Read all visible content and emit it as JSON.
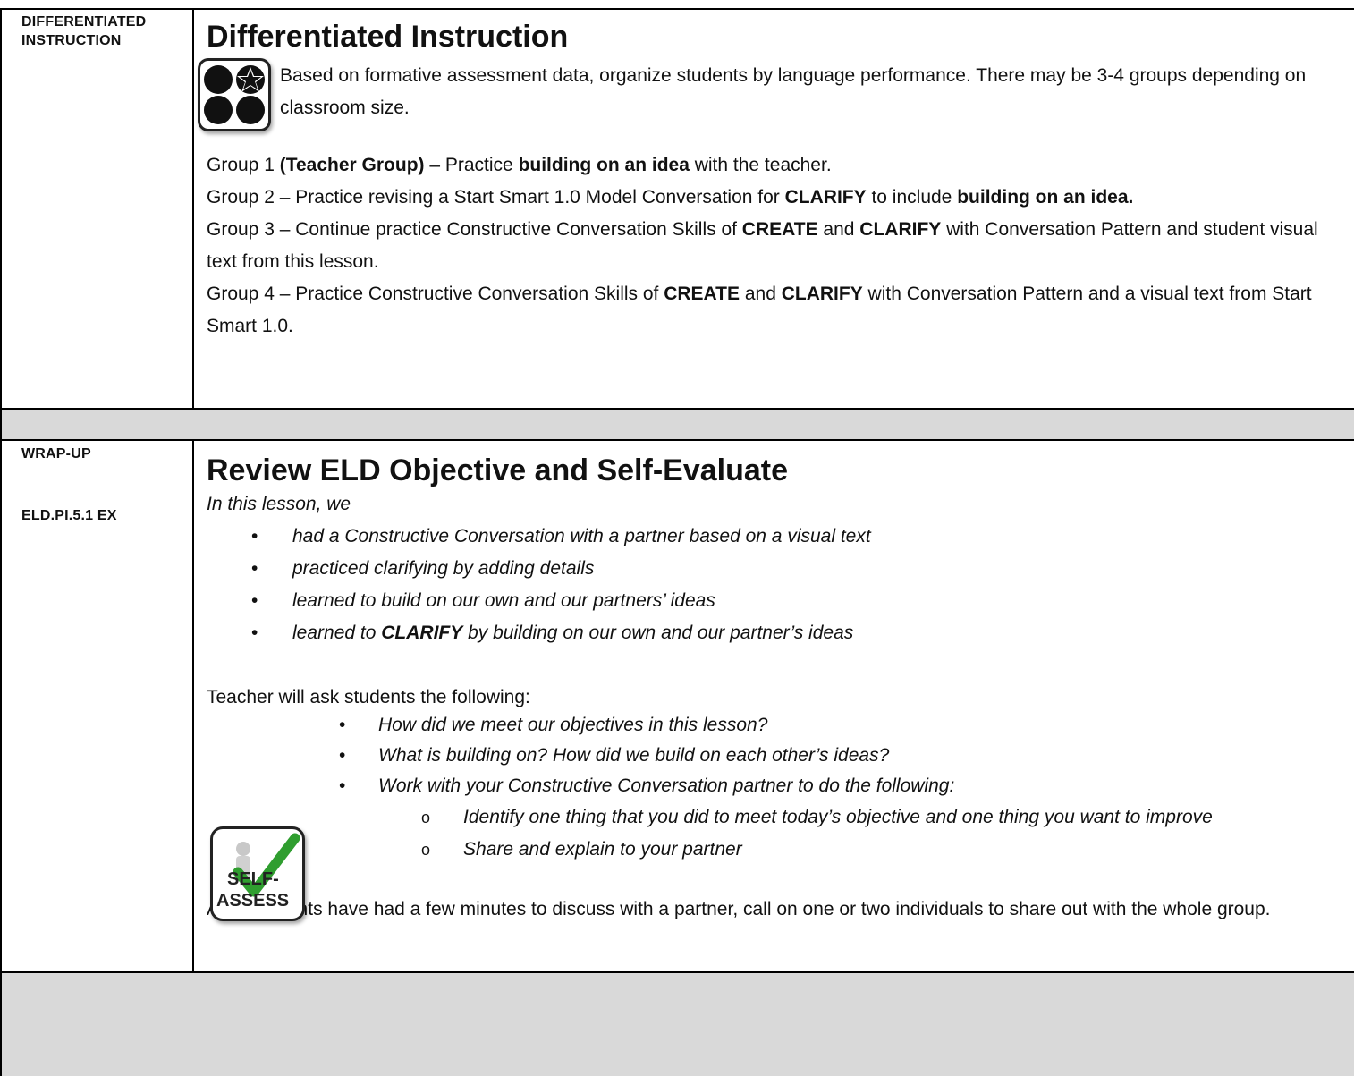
{
  "differentiated": {
    "label_line1": "DIFFERENTIATED",
    "label_line2": "INSTRUCTION",
    "heading": "Differentiated Instruction",
    "icon": "grouping-icon",
    "intro": "Based on formative assessment data, organize students by language performance.  There may be 3-4 groups depending on classroom size.",
    "group1": {
      "a": "Group 1 ",
      "b": "(Teacher Group)",
      "c": " – Practice ",
      "d": "building on an idea",
      "e": " with the teacher."
    },
    "group2": {
      "a": "Group 2 – Practice revising a Start Smart 1.0 Model Conversation for ",
      "b": "CLARIFY",
      "c": " to include ",
      "d": "building on an idea."
    },
    "group3": {
      "a": "Group 3 – Continue practice Constructive Conversation Skills of ",
      "b": "CREATE",
      "c": " and ",
      "d": "CLARIFY",
      "e": " with Conversation Pattern and student visual text from this lesson."
    },
    "group4": {
      "a": "Group 4 – Practice Constructive Conversation Skills of ",
      "b": "CREATE",
      "c": " and ",
      "d": "CLARIFY",
      "e": " with Conversation Pattern and a visual text from Start Smart 1.0."
    }
  },
  "wrapup": {
    "label": "WRAP-UP",
    "standard": "ELD.PI.5.1 EX",
    "heading": "Review ELD Objective and Self-Evaluate",
    "lead": "In this lesson, we",
    "bullets": [
      "had a Constructive Conversation with a partner based on a visual text",
      "practiced clarifying by adding details",
      "learned to build on our own and our partners’ ideas"
    ],
    "bullet4": {
      "a": "learned to ",
      "b": "CLARIFY",
      "c": " by building on our own and our partner’s ideas"
    },
    "teacher_lead": "Teacher will ask students the following:",
    "questions": [
      "How did we meet our objectives in this lesson?",
      "What is building on? How did we build on each other’s ideas?",
      "Work with your Constructive Conversation partner to do the following:"
    ],
    "sub": [
      "Identify one thing that you did to meet today’s objective and one thing you want to improve",
      "Share and explain to your partner"
    ],
    "icon": "self-assess-icon",
    "icon_text_1": "SELF-",
    "icon_text_2": "ASSESS",
    "closing": "After students have had a few minutes to discuss with a partner, call on one or two individuals to share out with the whole group."
  }
}
